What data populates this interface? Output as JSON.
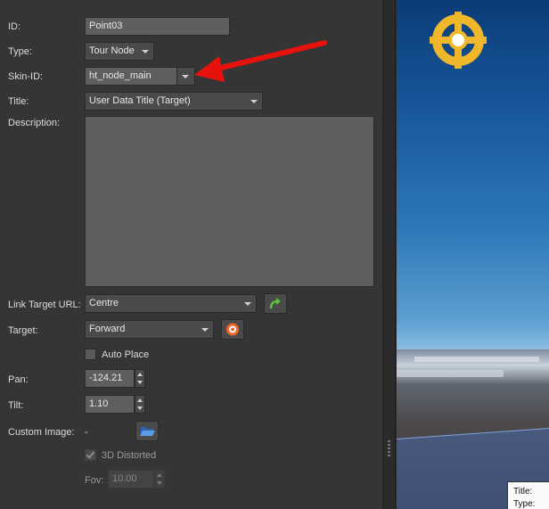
{
  "properties": {
    "id": {
      "label": "ID:",
      "value": "Point03"
    },
    "type": {
      "label": "Type:",
      "value": "Tour Node"
    },
    "skin_id": {
      "label": "Skin-ID:",
      "value": "ht_node_main"
    },
    "title": {
      "label": "Title:",
      "value": "User Data Title (Target)"
    },
    "description": {
      "label": "Description:",
      "value": ""
    },
    "link_target_url": {
      "label": "Link Target URL:",
      "value": "Centre"
    },
    "target": {
      "label": "Target:",
      "value": "Forward"
    },
    "auto_place": {
      "label": "Auto Place",
      "checked": false
    },
    "pan": {
      "label": "Pan:",
      "value": "-124.21"
    },
    "tilt": {
      "label": "Tilt:",
      "value": "1.10"
    },
    "custom_image": {
      "label": "Custom Image:",
      "value": "-"
    },
    "distorted_3d": {
      "label": "3D Distorted",
      "checked": true,
      "disabled": true
    },
    "fov": {
      "label": "Fov:",
      "value": "10.00",
      "disabled": true
    }
  },
  "viewer": {
    "tooltip": {
      "title": "Title:",
      "type": "Type:"
    }
  },
  "icons": {
    "link_button": "green-curved-arrow-icon",
    "target_button": "orange-target-icon",
    "custom_image_button": "blue-folder-icon",
    "hotspot": "gold-crosshair-icon",
    "annotation": "red-arrow-icon"
  },
  "colors": {
    "annotation_arrow": "#e8120c",
    "hotspot": "#f0b72a",
    "link_icon": "#5fbf3f",
    "target_icon": "#f0662a",
    "folder_icon": "#3c7fd6"
  }
}
